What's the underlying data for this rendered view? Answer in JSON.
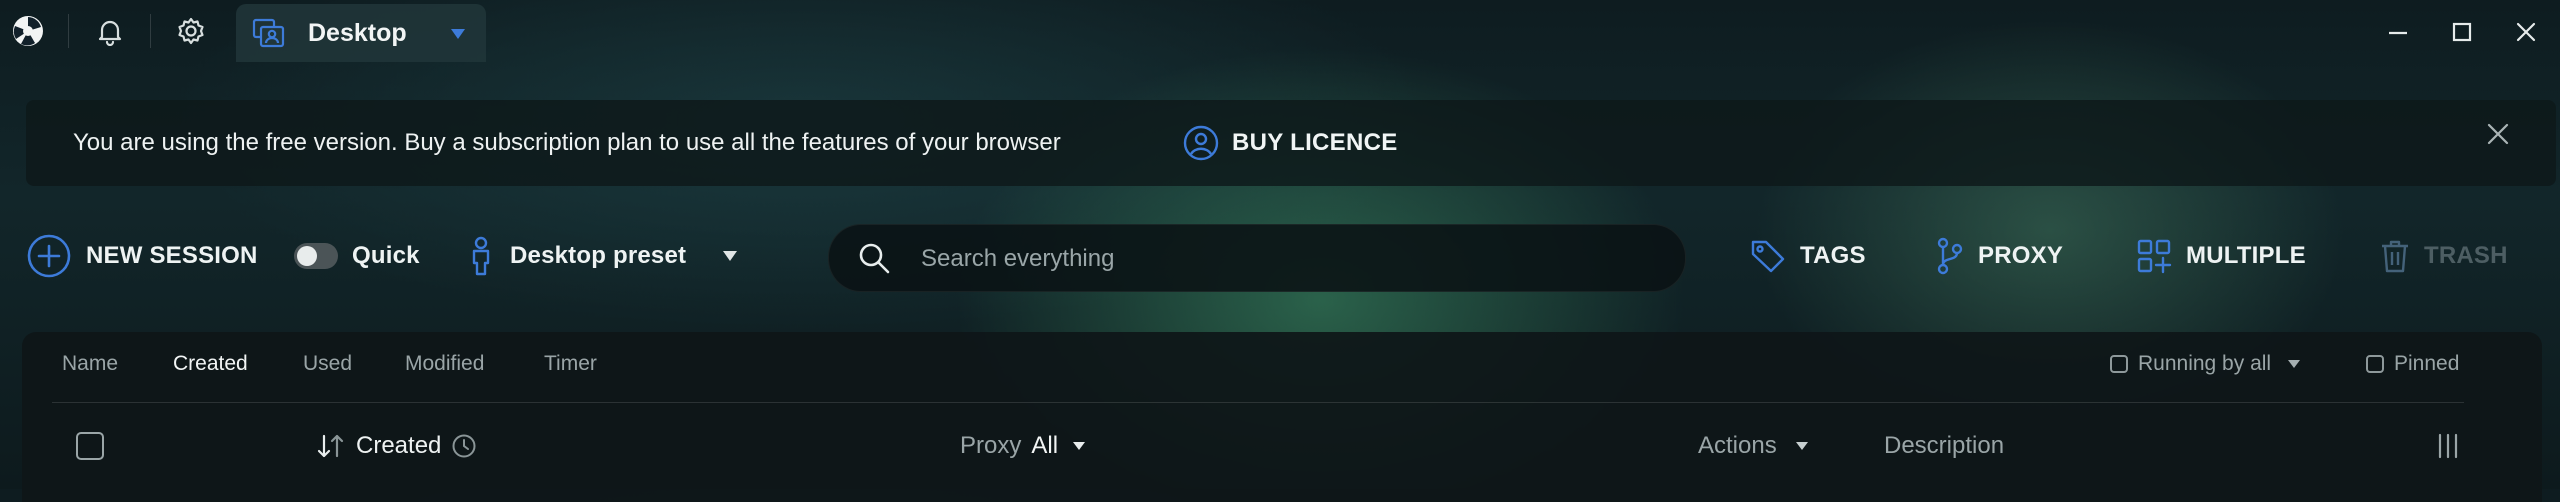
{
  "titlebar": {
    "app_logo_icon": "app-logo-icon",
    "notifications_icon": "bell-icon",
    "settings_icon": "gear-icon",
    "tab": {
      "label": "Desktop",
      "icon": "desktop-profile-icon",
      "dropdown_icon": "caret-down-icon"
    },
    "window_controls": [
      "minimize-icon",
      "maximize-icon",
      "close-icon"
    ]
  },
  "banner": {
    "message": "You are using the free version. Buy a subscription plan to use all the features of your browser",
    "buy_label": "BUY LICENCE",
    "buy_icon": "user-circle-icon",
    "close_icon": "close-icon"
  },
  "toolbar": {
    "new_session_label": "NEW SESSION",
    "quick_label": "Quick",
    "quick_enabled": false,
    "preset_label": "Desktop preset",
    "search_placeholder": "Search everything",
    "tags_label": "TAGS",
    "proxy_label": "PROXY",
    "multiple_label": "MULTIPLE",
    "trash_label": "TRASH"
  },
  "sort_tabs": {
    "items": [
      "Name",
      "Created",
      "Used",
      "Modified",
      "Timer"
    ],
    "active": "Created"
  },
  "filters": {
    "running_label": "Running by all",
    "pinned_label": "Pinned"
  },
  "columns": {
    "created_label": "Created",
    "proxy_label": "Proxy",
    "proxy_value": "All",
    "actions_label": "Actions",
    "description_label": "Description"
  },
  "colors": {
    "accent_blue": "#3d7bd9",
    "background": "#0e1c20",
    "panel": "#0e1618"
  }
}
